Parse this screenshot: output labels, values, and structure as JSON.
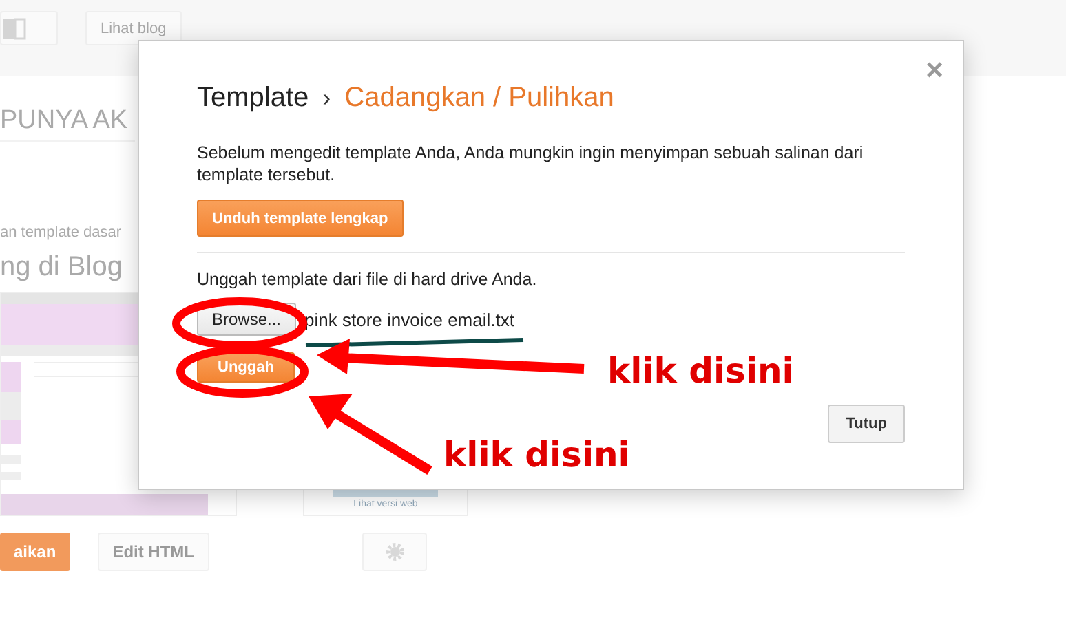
{
  "background": {
    "toolbar": [
      {
        "kind": "icon"
      },
      {
        "kind": "text",
        "label": "Lihat blog"
      }
    ],
    "blog_title": "PUNYA AK",
    "hint": "an template dasar",
    "section_title": "ng di Blog",
    "preview_link": "Lihat versi web",
    "actions": [
      {
        "kind": "primary",
        "label": "aikan"
      },
      {
        "kind": "text",
        "label": "Edit HTML"
      },
      {
        "kind": "icon"
      }
    ]
  },
  "dialog": {
    "breadcrumb": "Template",
    "separator": "›",
    "title": "Cadangkan / Pulihkan",
    "close": "×",
    "intro": "Sebelum mengedit template Anda, Anda mungkin ingin menyimpan sebuah salinan dari template tersebut.",
    "download_button": "Unduh template lengkap",
    "upload_label": "Unggah template dari file di hard drive Anda.",
    "browse_button": "Browse...",
    "file_name": "pink store invoice email.txt",
    "upload_button": "Unggah",
    "close_button": "Tutup"
  },
  "annotations": [
    {
      "label": "klik disini"
    },
    {
      "label": "klik disini"
    }
  ]
}
